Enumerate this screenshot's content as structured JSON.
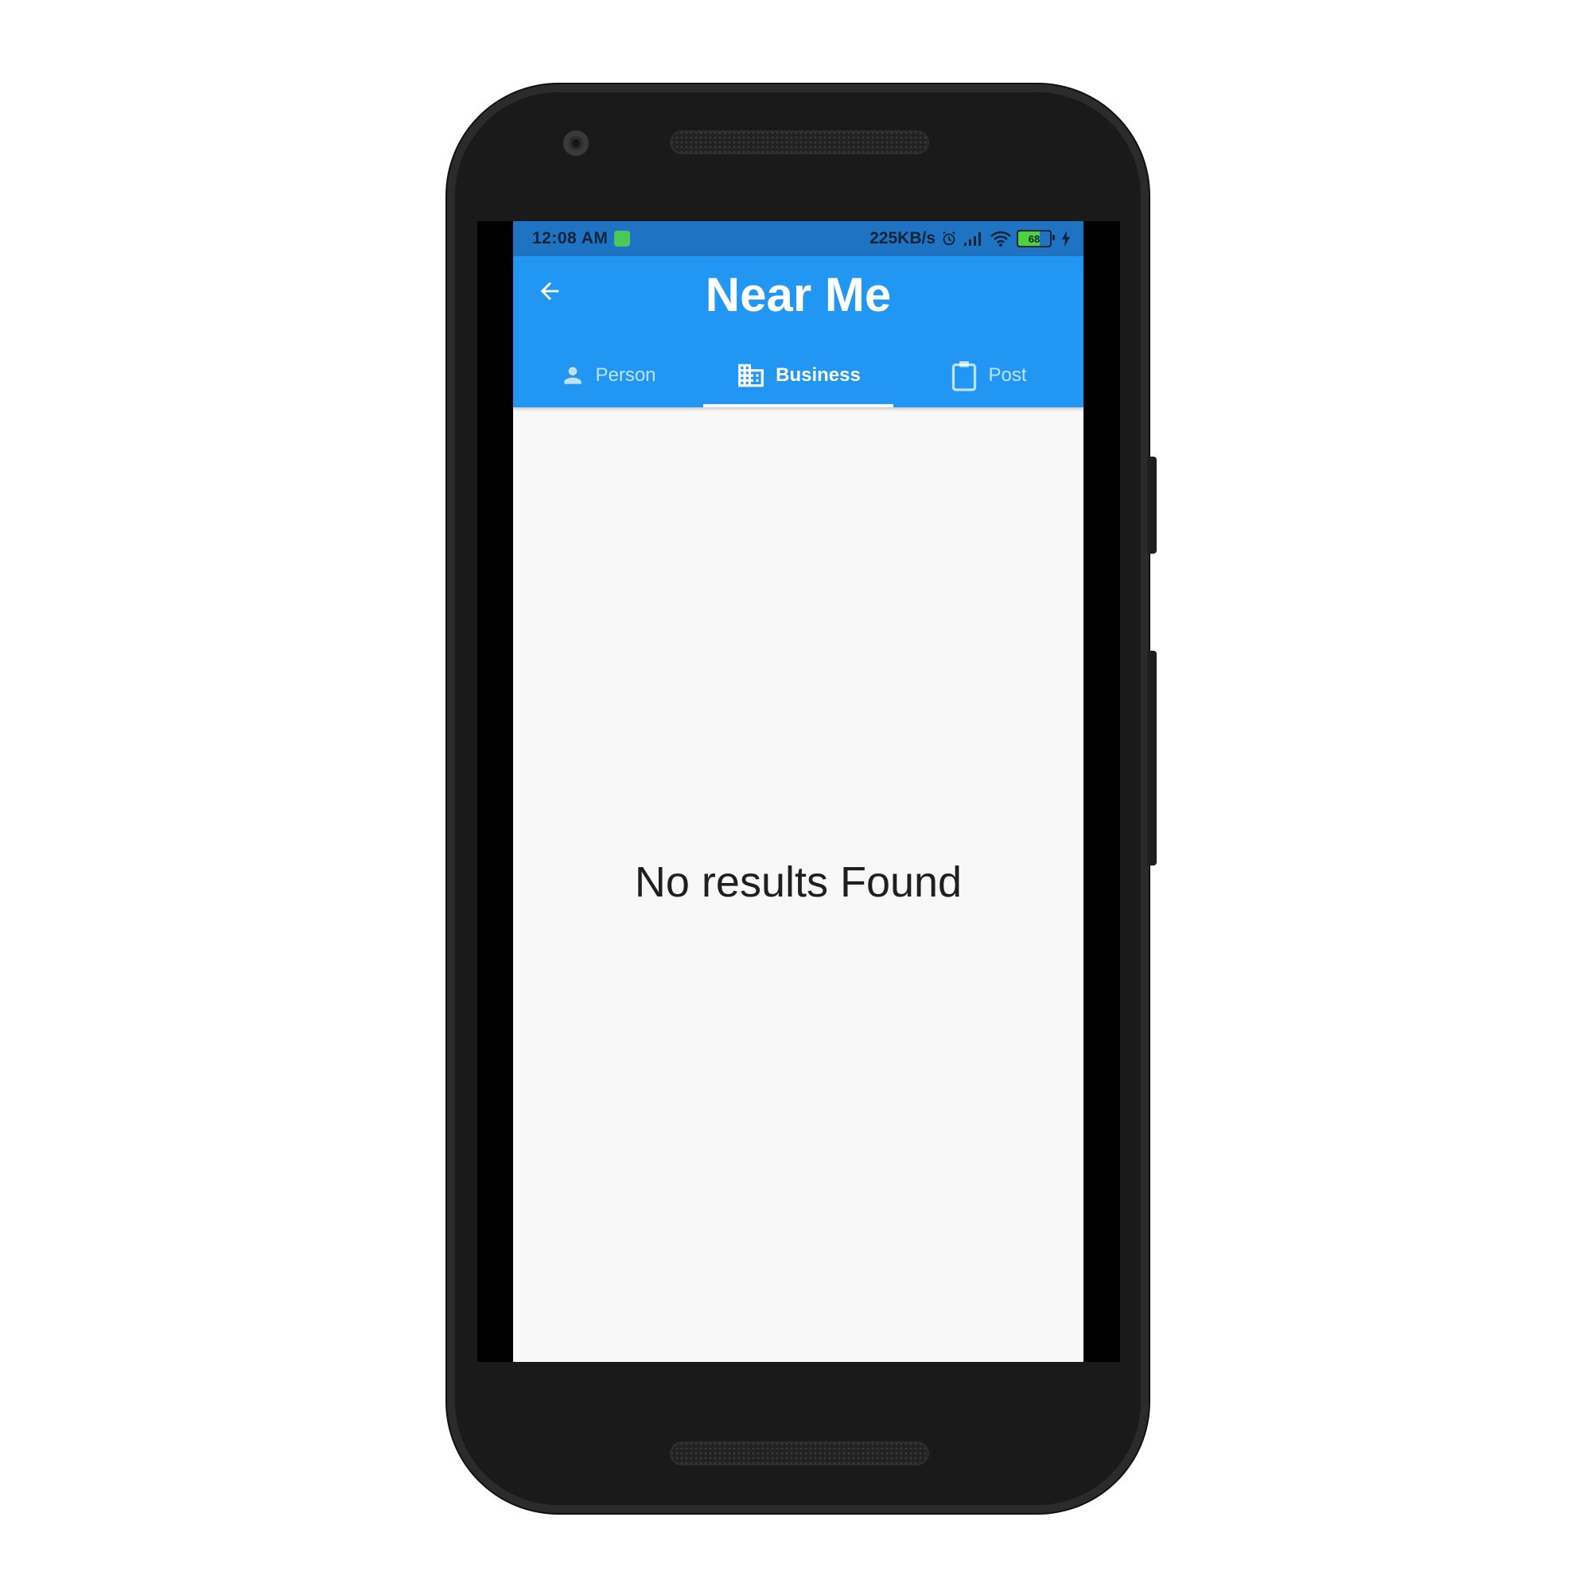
{
  "status_bar": {
    "time": "12:08 AM",
    "network_speed": "225KB/s",
    "battery_level": "68",
    "icons": [
      "app-notification-icon",
      "alarm-icon",
      "signal-icon",
      "wifi-icon",
      "battery-icon",
      "charging-icon"
    ]
  },
  "app_bar": {
    "title": "Near Me",
    "back_icon": "arrow-back-icon",
    "color": "#2196f3"
  },
  "tabs": [
    {
      "label": "Person",
      "icon": "person-icon",
      "active": false
    },
    {
      "label": "Business",
      "icon": "business-icon",
      "active": true
    },
    {
      "label": "Post",
      "icon": "clipboard-icon",
      "active": false
    }
  ],
  "content": {
    "empty_message": "No results Found"
  }
}
